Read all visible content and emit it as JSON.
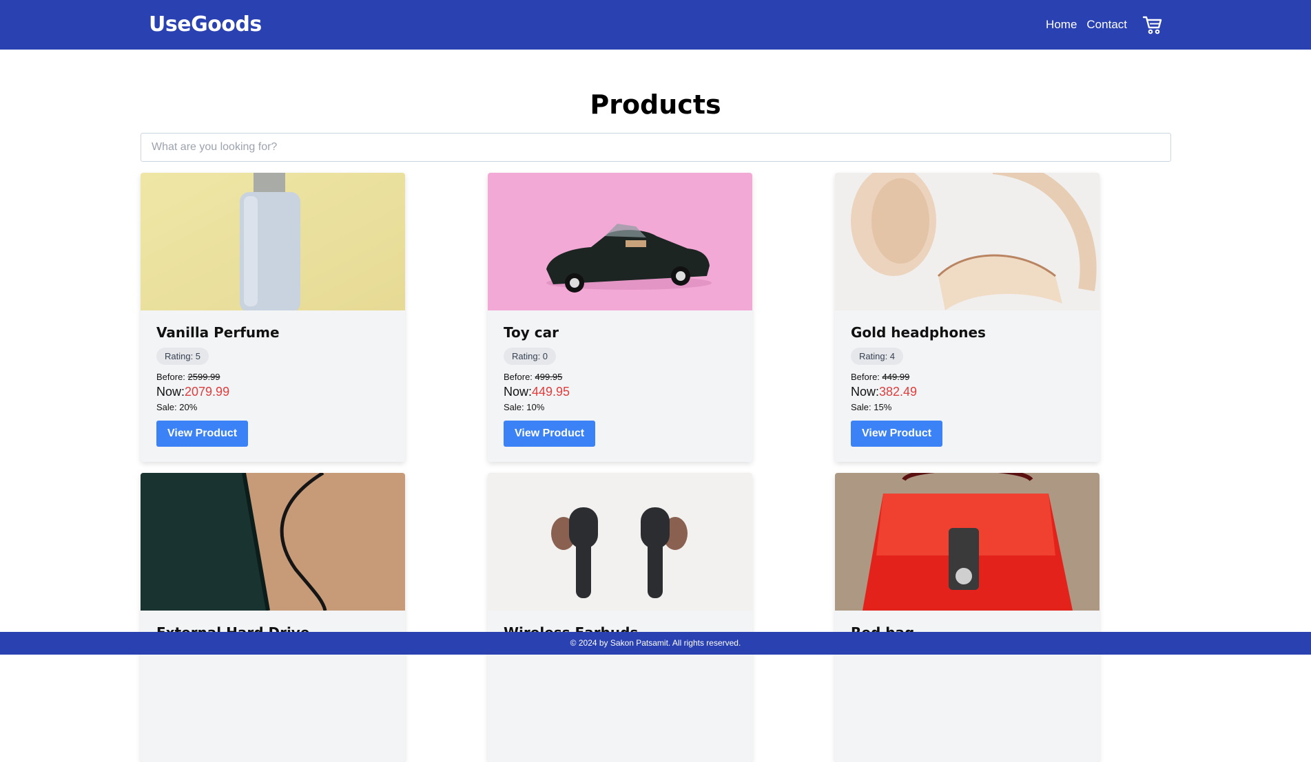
{
  "navbar": {
    "brand": "UseGoods",
    "links": [
      "Home",
      "Contact"
    ],
    "cart_icon": "cart-icon",
    "bg_color": "#2a41b2"
  },
  "main": {
    "title": "Products",
    "search_placeholder": "What are you looking for?"
  },
  "labels": {
    "rating_prefix": "Rating: ",
    "before_prefix": "Before: ",
    "now_prefix": "Now:",
    "sale_prefix": "Sale: ",
    "view_button": "View Product"
  },
  "products": [
    {
      "name": "Vanilla Perfume",
      "rating": "Rating: 5",
      "before": "2599.99",
      "now": "2079.99",
      "sale": "20%",
      "image": "perfume-image"
    },
    {
      "name": "Toy car",
      "rating": "Rating: 0",
      "before": "499.95",
      "now": "449.95",
      "sale": "10%",
      "image": "toy-car-image"
    },
    {
      "name": "Gold headphones",
      "rating": "Rating: 4",
      "before": "449.99",
      "now": "382.49",
      "sale": "15%",
      "image": "headphones-image"
    },
    {
      "name": "External Hard Drive",
      "image": "hard-drive-image"
    },
    {
      "name": "Wireless Earbuds",
      "image": "earbuds-image"
    },
    {
      "name": "Red bag",
      "image": "red-bag-image"
    }
  ],
  "footer": {
    "text": "© 2024 by Sakon Patsamit. All rights reserved."
  },
  "colors": {
    "accent": "#3b82f6",
    "price_now": "#e03c3c",
    "card_bg": "#f3f4f6"
  }
}
